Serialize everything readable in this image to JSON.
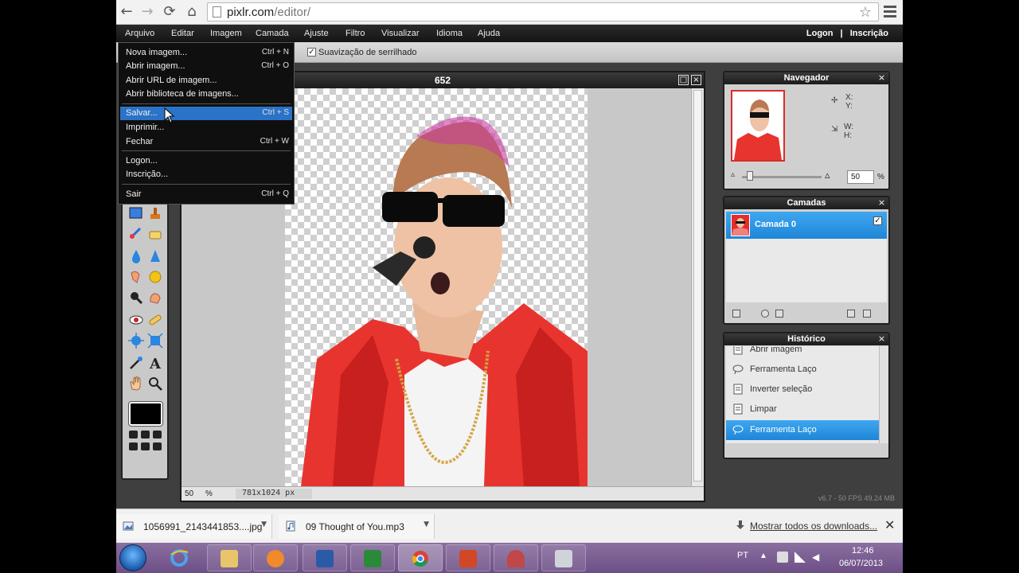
{
  "browser": {
    "url_host": "pixlr.com",
    "url_path": "/editor/",
    "nav_back_icon": "back-arrow-icon",
    "nav_forward_icon": "forward-arrow-icon",
    "nav_reload_icon": "reload-icon",
    "nav_home_icon": "home-icon"
  },
  "menubar": {
    "items": [
      "Arquivo",
      "Editar",
      "Imagem",
      "Camada",
      "Ajuste",
      "Filtro",
      "Visualizar",
      "Idioma",
      "Ajuda"
    ],
    "auth_login": "Logon",
    "auth_sep": "|",
    "auth_signup": "Inscrição"
  },
  "options_bar": {
    "antialias_label": "Suavização de serrilhado",
    "antialias_checked": true
  },
  "file_menu": {
    "items": [
      {
        "label": "Nova imagem...",
        "shortcut": "Ctrl + N"
      },
      {
        "label": "Abrir imagem...",
        "shortcut": "Ctrl + O"
      },
      {
        "label": "Abrir URL de imagem...",
        "shortcut": ""
      },
      {
        "label": "Abrir biblioteca de imagens...",
        "shortcut": ""
      },
      {
        "label": "Salvar...",
        "shortcut": "Ctrl + S"
      },
      {
        "label": "Imprimir...",
        "shortcut": ""
      },
      {
        "label": "Fechar",
        "shortcut": "Ctrl + W"
      },
      {
        "label": "Logon...",
        "shortcut": ""
      },
      {
        "label": "Inscrição...",
        "shortcut": ""
      },
      {
        "label": "Sair",
        "shortcut": "Ctrl + Q"
      }
    ],
    "highlighted": "Salvar..."
  },
  "document": {
    "title": "652",
    "zoom": "50",
    "zoom_unit": "%",
    "size": "781x1024 px"
  },
  "navigator": {
    "title": "Navegador",
    "x_label": "X:",
    "y_label": "Y:",
    "w_label": "W:",
    "h_label": "H:",
    "zoom": "50",
    "zoom_unit": "%",
    "zoom_fraction": 0.1
  },
  "layers": {
    "title": "Camadas",
    "items": [
      {
        "name": "Camada 0",
        "visible": true
      }
    ]
  },
  "history": {
    "title": "Histórico",
    "items": [
      "Abrir imagem",
      "Ferramenta Laço",
      "Inverter seleção",
      "Limpar",
      "Ferramenta Laço"
    ],
    "active_index": 4
  },
  "status": {
    "version": "v6.7 - 50 FPS 49.24 MB"
  },
  "downloads": {
    "items": [
      {
        "label": "1056991_2143441853....jpg",
        "icon": "image-file-icon"
      },
      {
        "label": "09 Thought of You.mp3",
        "icon": "audio-file-icon"
      }
    ],
    "show_all": "Mostrar todos os downloads..."
  },
  "taskbar": {
    "language": "PT",
    "time": "12:46",
    "date": "06/07/2013",
    "apps": [
      "internet-explorer-icon",
      "file-explorer-icon",
      "media-player-icon",
      "word-icon",
      "excel-icon",
      "chrome-icon",
      "powerpoint-icon",
      "paint-icon",
      "camera-app-icon"
    ]
  },
  "colors": {
    "accent_blue": "#2a73c7",
    "panel_dark": "#1c1c1c",
    "taskbar": "#7a5c92"
  }
}
